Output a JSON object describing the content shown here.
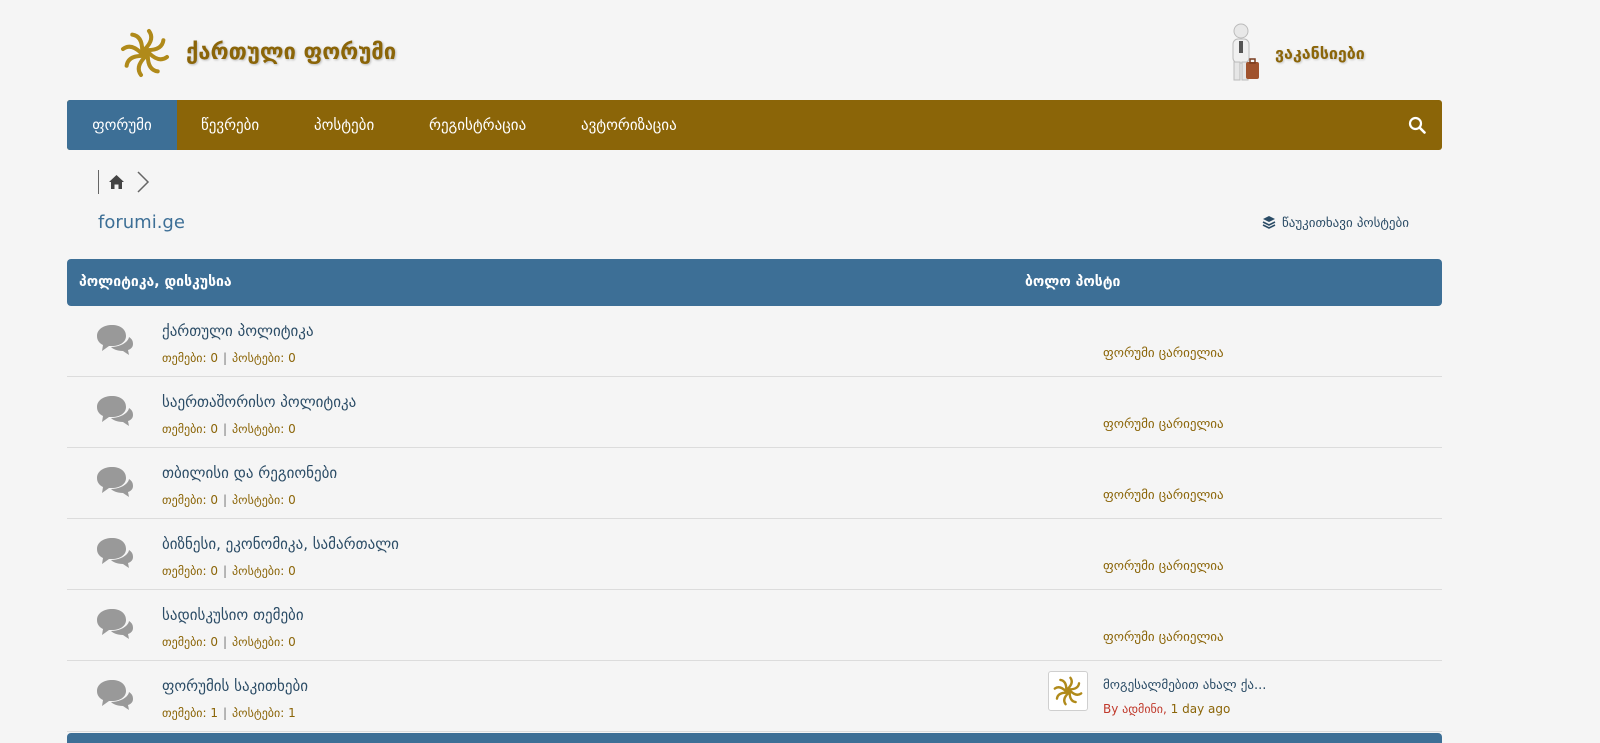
{
  "header": {
    "site_title": "ქართული ფორუმი",
    "jobs_label": "ვაკანსიები"
  },
  "nav": {
    "items": [
      {
        "label": "ფორუმი",
        "active": true
      },
      {
        "label": "წევრები"
      },
      {
        "label": "პოსტები"
      },
      {
        "label": "რეგისტრაცია"
      },
      {
        "label": "ავტორიზაცია"
      }
    ]
  },
  "breadcrumb": {
    "site_name": "forumi.ge"
  },
  "toolbar": {
    "unread_posts": "წაუკითხავი პოსტები"
  },
  "section": {
    "title": "პოლიტიკა, დისკუსია",
    "last_post_header": "ბოლო პოსტი"
  },
  "stats_labels": {
    "topics": "თემები:",
    "posts": "პოსტები:"
  },
  "forums": [
    {
      "title": "ქართული პოლიტიკა",
      "topics": "0",
      "posts": "0",
      "last": "ფორუმი ცარიელია"
    },
    {
      "title": "საერთაშორისო პოლიტიკა",
      "topics": "0",
      "posts": "0",
      "last": "ფორუმი ცარიელია"
    },
    {
      "title": "თბილისი და რეგიონები",
      "topics": "0",
      "posts": "0",
      "last": "ფორუმი ცარიელია"
    },
    {
      "title": "ბიზნესი, ეკონომიკა, სამართალი",
      "topics": "0",
      "posts": "0",
      "last": "ფორუმი ცარიელია"
    },
    {
      "title": "სადისკუსიო თემები",
      "topics": "0",
      "posts": "0",
      "last": "ფორუმი ცარიელია"
    },
    {
      "title": "ფორუმის საკითხები",
      "topics": "1",
      "posts": "1",
      "last_post": {
        "title": "მოგესალმებით ახალ ქა...",
        "by": "By ადმინი,",
        "time": "1 day ago"
      }
    }
  ],
  "colors": {
    "brand": "#8b6508",
    "accent": "#3d6f96",
    "background": "#f5f5f5"
  }
}
